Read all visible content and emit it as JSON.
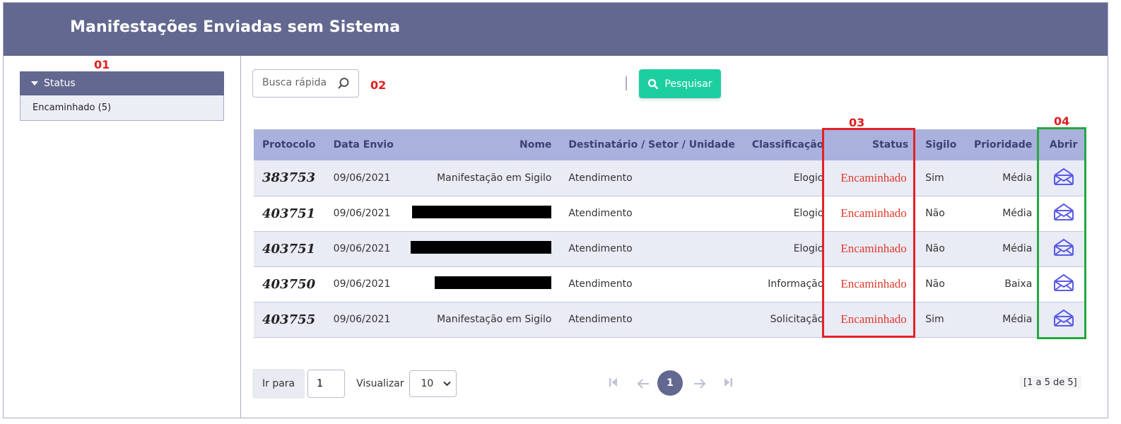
{
  "header": {
    "title": "Manifestações Enviadas sem Sistema"
  },
  "annotations": {
    "m01": "01",
    "m02": "02",
    "m03": "03",
    "m04": "04"
  },
  "sidebar": {
    "panel_title": "Status",
    "items": [
      {
        "label": "Encaminhado (5)"
      }
    ]
  },
  "toolbar": {
    "search_placeholder": "Busca rápida",
    "search_button": "Pesquisar"
  },
  "table": {
    "columns": [
      "Protocolo",
      "Data Envio",
      "Nome",
      "Destinatário / Setor / Unidade",
      "Classificação",
      "Status",
      "Sigilo",
      "Prioridade",
      "Abrir"
    ],
    "rows": [
      {
        "protocolo": "383753",
        "data": "09/06/2021",
        "nome": "Manifestação em Sigilo",
        "destinatario": "Atendimento",
        "classificacao": "Elogio",
        "status": "Encaminhado",
        "sigilo": "Sim",
        "prioridade": "Média"
      },
      {
        "protocolo": "403751",
        "data": "09/06/2021",
        "nome": "",
        "destinatario": "Atendimento",
        "classificacao": "Elogio",
        "status": "Encaminhado",
        "sigilo": "Não",
        "prioridade": "Média"
      },
      {
        "protocolo": "403751",
        "data": "09/06/2021",
        "nome": "",
        "destinatario": "Atendimento",
        "classificacao": "Elogio",
        "status": "Encaminhado",
        "sigilo": "Não",
        "prioridade": "Média"
      },
      {
        "protocolo": "403750",
        "data": "09/06/2021",
        "nome": "",
        "destinatario": "Atendimento",
        "classificacao": "Informação",
        "status": "Encaminhado",
        "sigilo": "Não",
        "prioridade": "Baixa"
      },
      {
        "protocolo": "403755",
        "data": "09/06/2021",
        "nome": "Manifestação em Sigilo",
        "destinatario": "Atendimento",
        "classificacao": "Solicitação",
        "status": "Encaminhado",
        "sigilo": "Sim",
        "prioridade": "Média"
      }
    ]
  },
  "pagination": {
    "goto_label": "Ir para",
    "goto_value": "1",
    "view_label": "Visualizar",
    "page_size": "10",
    "current_page": "1",
    "range_text": "[1 a 5 de 5]"
  },
  "icons": {
    "search": "search-icon",
    "open": "envelope-open-icon",
    "first": "first-page-icon",
    "prev": "prev-page-icon",
    "next": "next-page-icon",
    "last": "last-page-icon"
  },
  "colors": {
    "header_bg": "#636890",
    "accent_green": "#1dcfa0",
    "table_head": "#aab1dc",
    "status_red": "#e03a2a",
    "envelope": "#5a5ae6"
  }
}
